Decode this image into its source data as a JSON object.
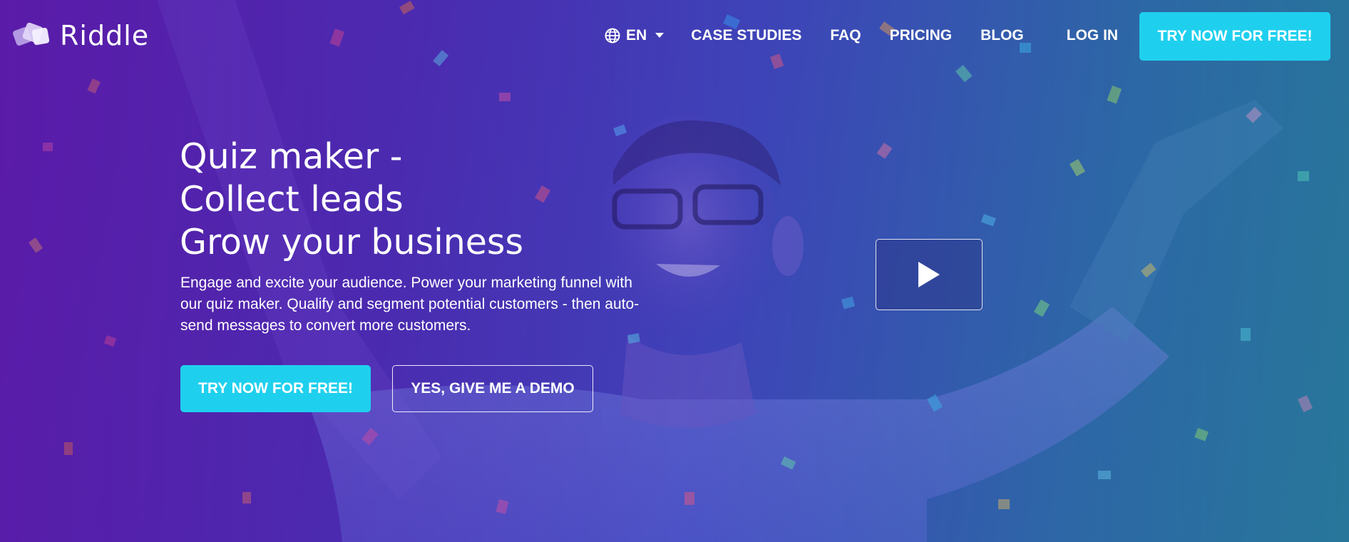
{
  "brand": {
    "name": "Riddle",
    "accent_color": "#1fd0ee"
  },
  "nav": {
    "language": {
      "icon": "globe-icon",
      "label": "EN"
    },
    "links": [
      {
        "label": "CASE STUDIES"
      },
      {
        "label": "FAQ"
      },
      {
        "label": "PRICING"
      },
      {
        "label": "BLOG"
      }
    ],
    "login_label": "LOG IN",
    "cta_label": "TRY NOW FOR FREE!"
  },
  "hero": {
    "headline_lines": [
      "Quiz maker -",
      "Collect leads",
      "Grow your business"
    ],
    "subtext": "Engage and excite your audience. Power your marketing funnel with our quiz maker. Qualify and segment potential customers - then auto-send messages to convert more customers.",
    "primary_button": "TRY NOW FOR FREE!",
    "secondary_button": "YES, GIVE ME A DEMO",
    "video_icon": "play-icon"
  }
}
